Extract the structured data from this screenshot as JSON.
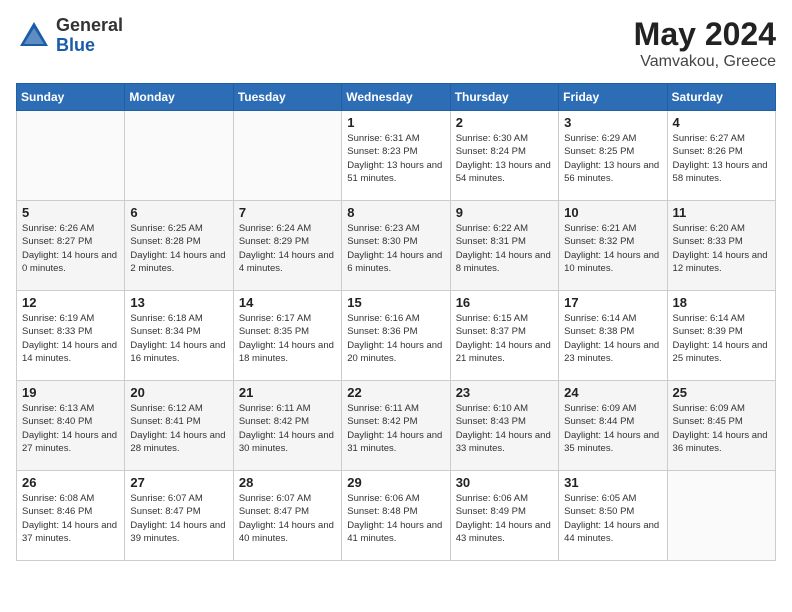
{
  "header": {
    "logo_general": "General",
    "logo_blue": "Blue",
    "month_year": "May 2024",
    "location": "Vamvakou, Greece"
  },
  "weekdays": [
    "Sunday",
    "Monday",
    "Tuesday",
    "Wednesday",
    "Thursday",
    "Friday",
    "Saturday"
  ],
  "weeks": [
    [
      {
        "day": "",
        "sunrise": "",
        "sunset": "",
        "daylight": ""
      },
      {
        "day": "",
        "sunrise": "",
        "sunset": "",
        "daylight": ""
      },
      {
        "day": "",
        "sunrise": "",
        "sunset": "",
        "daylight": ""
      },
      {
        "day": "1",
        "sunrise": "Sunrise: 6:31 AM",
        "sunset": "Sunset: 8:23 PM",
        "daylight": "Daylight: 13 hours and 51 minutes."
      },
      {
        "day": "2",
        "sunrise": "Sunrise: 6:30 AM",
        "sunset": "Sunset: 8:24 PM",
        "daylight": "Daylight: 13 hours and 54 minutes."
      },
      {
        "day": "3",
        "sunrise": "Sunrise: 6:29 AM",
        "sunset": "Sunset: 8:25 PM",
        "daylight": "Daylight: 13 hours and 56 minutes."
      },
      {
        "day": "4",
        "sunrise": "Sunrise: 6:27 AM",
        "sunset": "Sunset: 8:26 PM",
        "daylight": "Daylight: 13 hours and 58 minutes."
      }
    ],
    [
      {
        "day": "5",
        "sunrise": "Sunrise: 6:26 AM",
        "sunset": "Sunset: 8:27 PM",
        "daylight": "Daylight: 14 hours and 0 minutes."
      },
      {
        "day": "6",
        "sunrise": "Sunrise: 6:25 AM",
        "sunset": "Sunset: 8:28 PM",
        "daylight": "Daylight: 14 hours and 2 minutes."
      },
      {
        "day": "7",
        "sunrise": "Sunrise: 6:24 AM",
        "sunset": "Sunset: 8:29 PM",
        "daylight": "Daylight: 14 hours and 4 minutes."
      },
      {
        "day": "8",
        "sunrise": "Sunrise: 6:23 AM",
        "sunset": "Sunset: 8:30 PM",
        "daylight": "Daylight: 14 hours and 6 minutes."
      },
      {
        "day": "9",
        "sunrise": "Sunrise: 6:22 AM",
        "sunset": "Sunset: 8:31 PM",
        "daylight": "Daylight: 14 hours and 8 minutes."
      },
      {
        "day": "10",
        "sunrise": "Sunrise: 6:21 AM",
        "sunset": "Sunset: 8:32 PM",
        "daylight": "Daylight: 14 hours and 10 minutes."
      },
      {
        "day": "11",
        "sunrise": "Sunrise: 6:20 AM",
        "sunset": "Sunset: 8:33 PM",
        "daylight": "Daylight: 14 hours and 12 minutes."
      }
    ],
    [
      {
        "day": "12",
        "sunrise": "Sunrise: 6:19 AM",
        "sunset": "Sunset: 8:33 PM",
        "daylight": "Daylight: 14 hours and 14 minutes."
      },
      {
        "day": "13",
        "sunrise": "Sunrise: 6:18 AM",
        "sunset": "Sunset: 8:34 PM",
        "daylight": "Daylight: 14 hours and 16 minutes."
      },
      {
        "day": "14",
        "sunrise": "Sunrise: 6:17 AM",
        "sunset": "Sunset: 8:35 PM",
        "daylight": "Daylight: 14 hours and 18 minutes."
      },
      {
        "day": "15",
        "sunrise": "Sunrise: 6:16 AM",
        "sunset": "Sunset: 8:36 PM",
        "daylight": "Daylight: 14 hours and 20 minutes."
      },
      {
        "day": "16",
        "sunrise": "Sunrise: 6:15 AM",
        "sunset": "Sunset: 8:37 PM",
        "daylight": "Daylight: 14 hours and 21 minutes."
      },
      {
        "day": "17",
        "sunrise": "Sunrise: 6:14 AM",
        "sunset": "Sunset: 8:38 PM",
        "daylight": "Daylight: 14 hours and 23 minutes."
      },
      {
        "day": "18",
        "sunrise": "Sunrise: 6:14 AM",
        "sunset": "Sunset: 8:39 PM",
        "daylight": "Daylight: 14 hours and 25 minutes."
      }
    ],
    [
      {
        "day": "19",
        "sunrise": "Sunrise: 6:13 AM",
        "sunset": "Sunset: 8:40 PM",
        "daylight": "Daylight: 14 hours and 27 minutes."
      },
      {
        "day": "20",
        "sunrise": "Sunrise: 6:12 AM",
        "sunset": "Sunset: 8:41 PM",
        "daylight": "Daylight: 14 hours and 28 minutes."
      },
      {
        "day": "21",
        "sunrise": "Sunrise: 6:11 AM",
        "sunset": "Sunset: 8:42 PM",
        "daylight": "Daylight: 14 hours and 30 minutes."
      },
      {
        "day": "22",
        "sunrise": "Sunrise: 6:11 AM",
        "sunset": "Sunset: 8:42 PM",
        "daylight": "Daylight: 14 hours and 31 minutes."
      },
      {
        "day": "23",
        "sunrise": "Sunrise: 6:10 AM",
        "sunset": "Sunset: 8:43 PM",
        "daylight": "Daylight: 14 hours and 33 minutes."
      },
      {
        "day": "24",
        "sunrise": "Sunrise: 6:09 AM",
        "sunset": "Sunset: 8:44 PM",
        "daylight": "Daylight: 14 hours and 35 minutes."
      },
      {
        "day": "25",
        "sunrise": "Sunrise: 6:09 AM",
        "sunset": "Sunset: 8:45 PM",
        "daylight": "Daylight: 14 hours and 36 minutes."
      }
    ],
    [
      {
        "day": "26",
        "sunrise": "Sunrise: 6:08 AM",
        "sunset": "Sunset: 8:46 PM",
        "daylight": "Daylight: 14 hours and 37 minutes."
      },
      {
        "day": "27",
        "sunrise": "Sunrise: 6:07 AM",
        "sunset": "Sunset: 8:47 PM",
        "daylight": "Daylight: 14 hours and 39 minutes."
      },
      {
        "day": "28",
        "sunrise": "Sunrise: 6:07 AM",
        "sunset": "Sunset: 8:47 PM",
        "daylight": "Daylight: 14 hours and 40 minutes."
      },
      {
        "day": "29",
        "sunrise": "Sunrise: 6:06 AM",
        "sunset": "Sunset: 8:48 PM",
        "daylight": "Daylight: 14 hours and 41 minutes."
      },
      {
        "day": "30",
        "sunrise": "Sunrise: 6:06 AM",
        "sunset": "Sunset: 8:49 PM",
        "daylight": "Daylight: 14 hours and 43 minutes."
      },
      {
        "day": "31",
        "sunrise": "Sunrise: 6:05 AM",
        "sunset": "Sunset: 8:50 PM",
        "daylight": "Daylight: 14 hours and 44 minutes."
      },
      {
        "day": "",
        "sunrise": "",
        "sunset": "",
        "daylight": ""
      }
    ]
  ]
}
